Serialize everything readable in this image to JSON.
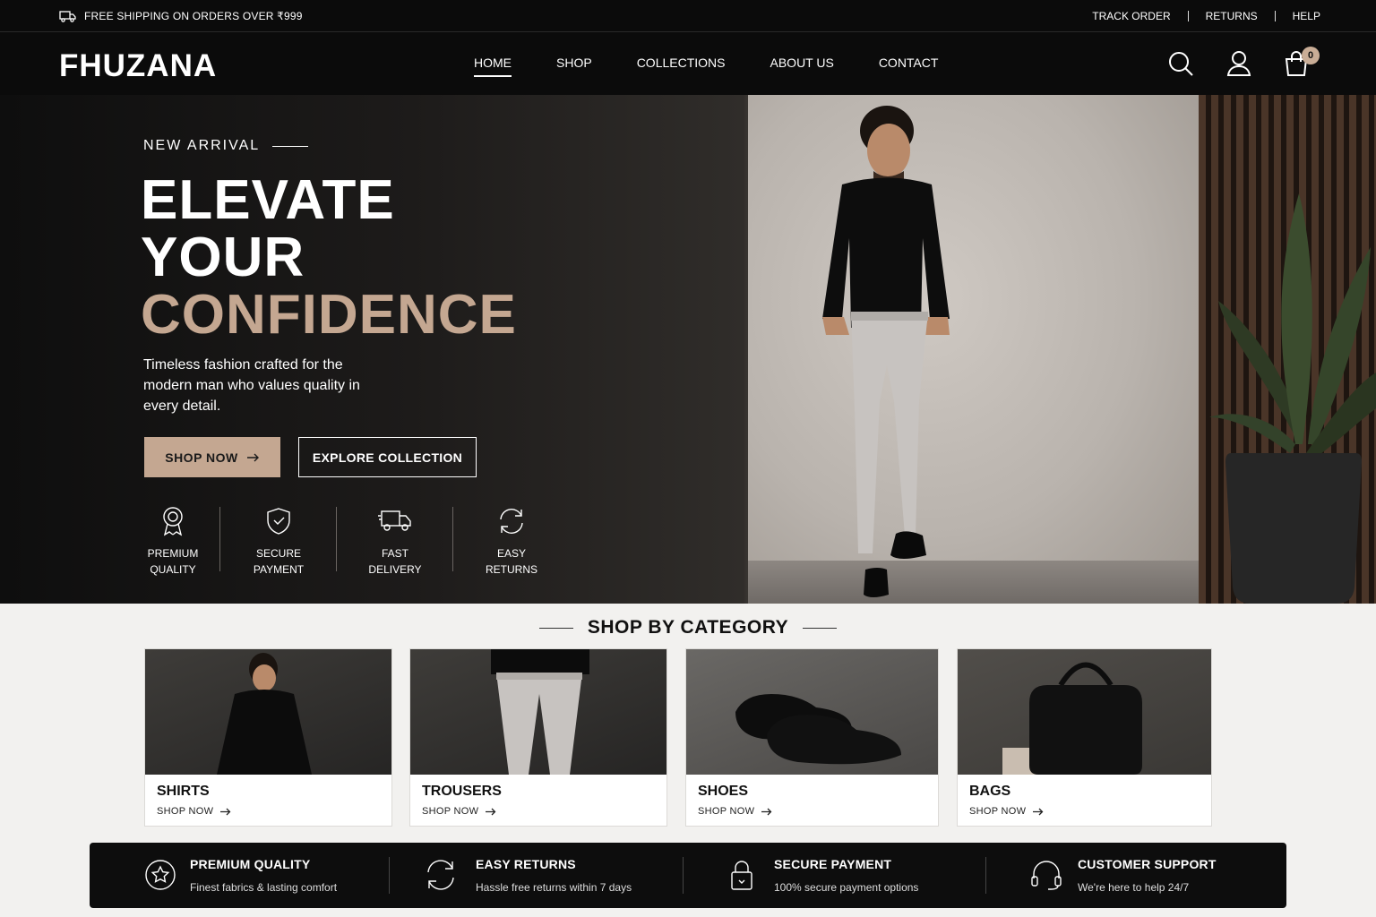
{
  "topbar": {
    "shipping": "FREE SHIPPING ON ORDERS OVER ₹999",
    "links": [
      "TRACK ORDER",
      "RETURNS",
      "HELP"
    ]
  },
  "header": {
    "logo": "FHUZANA",
    "nav": [
      "HOME",
      "SHOP",
      "COLLECTIONS",
      "ABOUT US",
      "CONTACT"
    ],
    "active_nav": "HOME",
    "cart_count": "0",
    "icons": [
      "search-icon",
      "account-icon",
      "cart-icon"
    ]
  },
  "hero": {
    "eyebrow": "NEW ARRIVAL",
    "line1": "ELEVATE",
    "line2": "YOUR",
    "line3": "CONFIDENCE",
    "subtext": "Timeless fashion crafted for the modern man who values quality in every detail.",
    "primary_button": "SHOP NOW",
    "secondary_button": "EXPLORE COLLECTION",
    "features": [
      {
        "line1": "PREMIUM",
        "line2": "QUALITY",
        "icon": "award-icon"
      },
      {
        "line1": "SECURE",
        "line2": "PAYMENT",
        "icon": "shield-icon"
      },
      {
        "line1": "FAST",
        "line2": "DELIVERY",
        "icon": "truck-icon"
      },
      {
        "line1": "EASY",
        "line2": "RETURNS",
        "icon": "refresh-icon"
      }
    ]
  },
  "categories": {
    "title": "SHOP BY CATEGORY",
    "items": [
      {
        "name": "SHIRTS",
        "cta": "SHOP NOW"
      },
      {
        "name": "TROUSERS",
        "cta": "SHOP NOW"
      },
      {
        "name": "SHOES",
        "cta": "SHOP NOW"
      },
      {
        "name": "BAGS",
        "cta": "SHOP NOW"
      }
    ]
  },
  "benefits": [
    {
      "title": "PREMIUM QUALITY",
      "desc": "Finest fabrics & lasting comfort",
      "icon": "star-badge-icon"
    },
    {
      "title": "EASY RETURNS",
      "desc": "Hassle free returns within 7 days",
      "icon": "refresh-icon"
    },
    {
      "title": "SECURE PAYMENT",
      "desc": "100% secure payment options",
      "icon": "lock-icon"
    },
    {
      "title": "CUSTOMER SUPPORT",
      "desc": "We're here to help 24/7",
      "icon": "headset-icon"
    }
  ],
  "colors": {
    "accent": "#c4a791",
    "dark": "#0b0b0b",
    "background": "#f2f1ef"
  }
}
